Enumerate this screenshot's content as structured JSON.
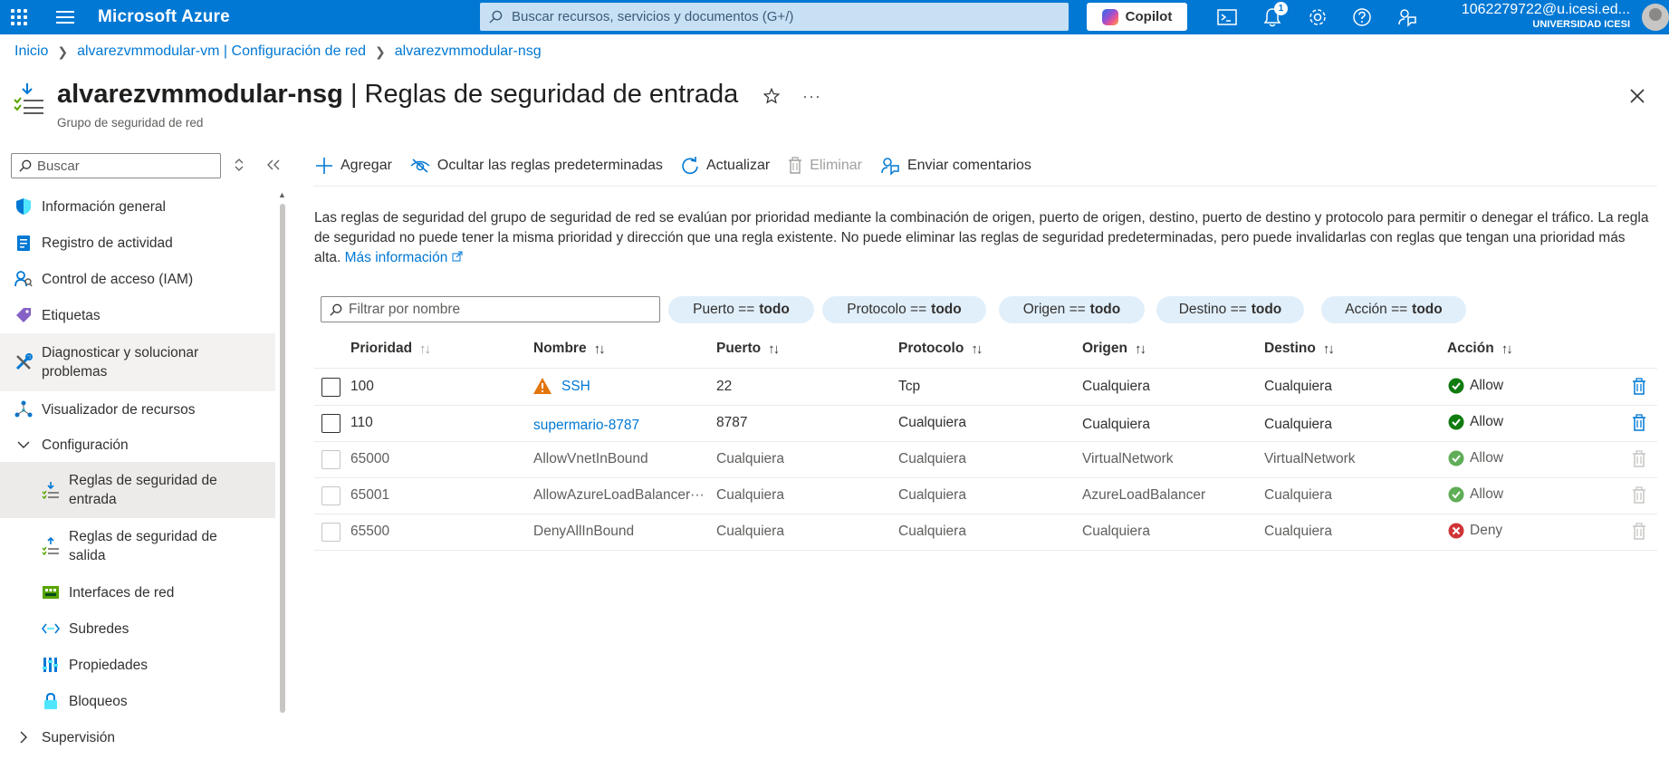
{
  "topbar": {
    "brand": "Microsoft Azure",
    "search_placeholder": "Buscar recursos, servicios y documentos (G+/)",
    "copilot_label": "Copilot",
    "notifications_count": "1",
    "user_email": "1062279722@u.icesi.ed...",
    "user_org": "UNIVERSIDAD ICESI",
    "accent_color": "#0078d4"
  },
  "breadcrumb": {
    "items": [
      "Inicio",
      "alvarezvmmodular-vm | Configuración de red",
      "alvarezvmmodular-nsg"
    ]
  },
  "header": {
    "title_resource": "alvarezvmmodular-nsg",
    "title_page": " | Reglas de seguridad de entrada",
    "subtitle": "Grupo de seguridad de red",
    "more": "···"
  },
  "sidebar": {
    "search_placeholder": "Buscar",
    "items": [
      {
        "label": "Información general",
        "icon": "shield-icon"
      },
      {
        "label": "Registro de actividad",
        "icon": "activity-log-icon"
      },
      {
        "label": "Control de acceso (IAM)",
        "icon": "iam-icon"
      },
      {
        "label": "Etiquetas",
        "icon": "tag-icon"
      },
      {
        "label": "Diagnosticar y solucionar problemas",
        "icon": "wrench-icon"
      },
      {
        "label": "Visualizador de recursos",
        "icon": "resource-visualizer-icon"
      },
      {
        "label": "Configuración",
        "icon": "chevron-down-icon"
      },
      {
        "label": "Reglas de seguridad de entrada",
        "icon": "inbound-rules-icon"
      },
      {
        "label": "Reglas de seguridad de salida",
        "icon": "outbound-rules-icon"
      },
      {
        "label": "Interfaces de red",
        "icon": "network-interface-icon"
      },
      {
        "label": "Subredes",
        "icon": "subnet-icon"
      },
      {
        "label": "Propiedades",
        "icon": "properties-icon"
      },
      {
        "label": "Bloqueos",
        "icon": "lock-icon"
      },
      {
        "label": "Supervisión",
        "icon": "chevron-right-icon"
      }
    ]
  },
  "commandbar": {
    "add": "Agregar",
    "hide_defaults": "Ocultar las reglas predeterminadas",
    "refresh": "Actualizar",
    "delete": "Eliminar",
    "feedback": "Enviar comentarios"
  },
  "description": {
    "text": "Las reglas de seguridad del grupo de seguridad de red se evalúan por prioridad mediante la combinación de origen, puerto de origen, destino, puerto de destino y protocolo para permitir o denegar el tráfico. La regla de seguridad no puede tener la misma prioridad y dirección que una regla existente. No puede eliminar las reglas de seguridad predeterminadas, pero puede invalidarlas con reglas que tengan una prioridad más alta.",
    "link": "Más información"
  },
  "filters": {
    "name_placeholder": "Filtrar por nombre",
    "pills": [
      {
        "key": "Puerto ==",
        "value": "todo"
      },
      {
        "key": "Protocolo ==",
        "value": "todo"
      },
      {
        "key": "Origen ==",
        "value": "todo"
      },
      {
        "key": "Destino ==",
        "value": "todo"
      },
      {
        "key": "Acción ==",
        "value": "todo"
      }
    ]
  },
  "table": {
    "columns": [
      "Prioridad",
      "Nombre",
      "Puerto",
      "Protocolo",
      "Origen",
      "Destino",
      "Acción"
    ],
    "rows": [
      {
        "priority": "100",
        "name": "SSH",
        "port": "22",
        "protocol": "Tcp",
        "source": "Cualquiera",
        "destination": "Cualquiera",
        "action": "Allow",
        "warning": true,
        "editable": true
      },
      {
        "priority": "110",
        "name": "supermario-8787",
        "port": "8787",
        "protocol": "Cualquiera",
        "source": "Cualquiera",
        "destination": "Cualquiera",
        "action": "Allow",
        "warning": false,
        "editable": true
      },
      {
        "priority": "65000",
        "name": "AllowVnetInBound",
        "port": "Cualquiera",
        "protocol": "Cualquiera",
        "source": "VirtualNetwork",
        "destination": "VirtualNetwork",
        "action": "Allow",
        "warning": false,
        "editable": false
      },
      {
        "priority": "65001",
        "name": "AllowAzureLoadBalancer···",
        "port": "Cualquiera",
        "protocol": "Cualquiera",
        "source": "AzureLoadBalancer",
        "destination": "Cualquiera",
        "action": "Allow",
        "warning": false,
        "editable": false
      },
      {
        "priority": "65500",
        "name": "DenyAllInBound",
        "port": "Cualquiera",
        "protocol": "Cualquiera",
        "source": "Cualquiera",
        "destination": "Cualquiera",
        "action": "Deny",
        "warning": false,
        "editable": false
      }
    ],
    "colors": {
      "allow": "#107c10",
      "deny": "#d13438",
      "warning": "#e3750b",
      "link": "#0078d4"
    }
  }
}
